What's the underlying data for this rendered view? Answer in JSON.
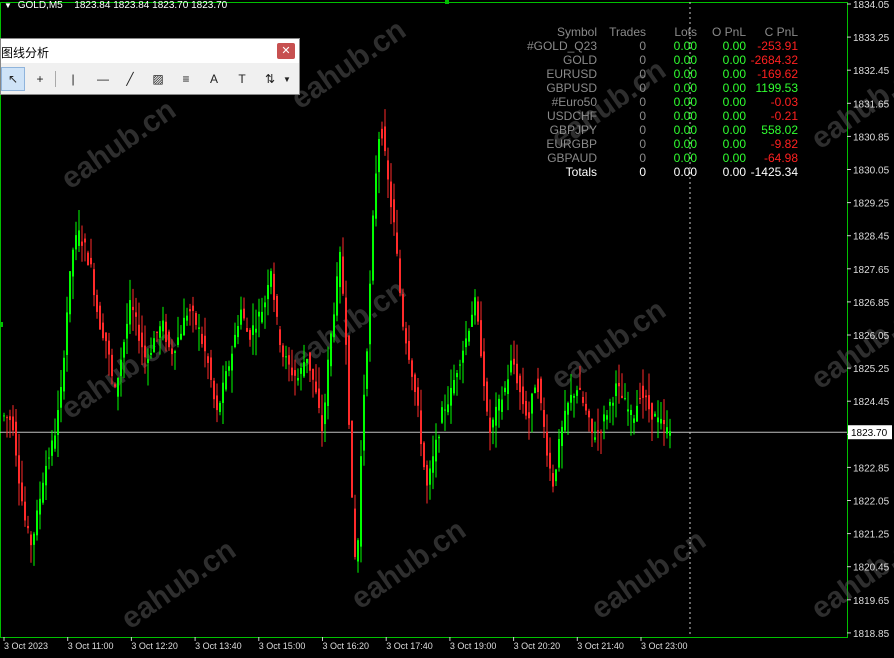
{
  "chart": {
    "symbol_title": "GOLD,M5",
    "ohlc": [
      "1823.84",
      "1823.84",
      "1823.70",
      "1823.70"
    ],
    "current_price": "1823.70",
    "price_axis_labels": [
      "1834.05",
      "1833.25",
      "1832.45",
      "1831.65",
      "1830.85",
      "1830.05",
      "1829.25",
      "1828.45",
      "1827.65",
      "1826.85",
      "1826.05",
      "1825.25",
      "1824.45",
      "1823.65",
      "1822.85",
      "1822.05",
      "1821.25",
      "1820.45",
      "1819.65",
      "1818.85"
    ],
    "time_axis_labels": [
      "3 Oct 2023",
      "3 Oct 11:00",
      "3 Oct 12:20",
      "3 Oct 13:40",
      "3 Oct 15:00",
      "3 Oct 16:20",
      "3 Oct 17:40",
      "3 Oct 19:00",
      "3 Oct 20:20",
      "3 Oct 21:40",
      "3 Oct 23:00"
    ],
    "watermark_text": "eahub.cn",
    "colors": {
      "bull": "#00ff00",
      "bear": "#ff2a2a",
      "grid_line": "#c0c0c0",
      "frame": "#00c000"
    }
  },
  "toolbar": {
    "title": "图线分析",
    "close_icon": "close-icon",
    "tools": [
      {
        "name": "cursor-icon",
        "glyph": "↖"
      },
      {
        "name": "crosshair-icon",
        "glyph": "+"
      },
      {
        "name": "vertical-line-icon",
        "glyph": "|"
      },
      {
        "name": "horizontal-line-icon",
        "glyph": "—"
      },
      {
        "name": "trendline-icon",
        "glyph": "╱"
      },
      {
        "name": "equidistant-channel-icon",
        "glyph": "▨"
      },
      {
        "name": "fibonacci-icon",
        "glyph": "≡"
      },
      {
        "name": "text-icon",
        "glyph": "A"
      },
      {
        "name": "text-label-icon",
        "glyph": "T"
      },
      {
        "name": "arrows-icon",
        "glyph": "⇅"
      }
    ]
  },
  "pnl": {
    "headers": {
      "symbol": "Symbol",
      "trades": "Trades",
      "lots": "Lots",
      "opnl": "O PnL",
      "cpnl": "C PnL"
    },
    "rows": [
      {
        "symbol": "#GOLD_Q23",
        "trades": "0",
        "lots": "0.00",
        "opnl": "0.00",
        "cpnl": "-253.91",
        "cpnl_color": "#ff2020"
      },
      {
        "symbol": "GOLD",
        "trades": "0",
        "lots": "0.00",
        "opnl": "0.00",
        "cpnl": "-2684.32",
        "cpnl_color": "#ff2020"
      },
      {
        "symbol": "EURUSD",
        "trades": "0",
        "lots": "0.00",
        "opnl": "0.00",
        "cpnl": "-169.62",
        "cpnl_color": "#ff2020"
      },
      {
        "symbol": "GBPUSD",
        "trades": "0",
        "lots": "0.00",
        "opnl": "0.00",
        "cpnl": "1199.53",
        "cpnl_color": "#30ff30"
      },
      {
        "symbol": "#Euro50",
        "trades": "0",
        "lots": "0.00",
        "opnl": "0.00",
        "cpnl": "-0.03",
        "cpnl_color": "#ff2020"
      },
      {
        "symbol": "USDCHF",
        "trades": "0",
        "lots": "0.00",
        "opnl": "0.00",
        "cpnl": "-0.21",
        "cpnl_color": "#ff2020"
      },
      {
        "symbol": "GBPJPY",
        "trades": "0",
        "lots": "0.00",
        "opnl": "0.00",
        "cpnl": "558.02",
        "cpnl_color": "#30ff30"
      },
      {
        "symbol": "EURGBP",
        "trades": "0",
        "lots": "0.00",
        "opnl": "0.00",
        "cpnl": "-9.82",
        "cpnl_color": "#ff2020"
      },
      {
        "symbol": "GBPAUD",
        "trades": "0",
        "lots": "0.00",
        "opnl": "0.00",
        "cpnl": "-64.98",
        "cpnl_color": "#ff2020"
      }
    ],
    "totals": {
      "label": "Totals",
      "trades": "0",
      "lots": "0.00",
      "opnl": "0.00",
      "cpnl": "-1425.34"
    }
  }
}
